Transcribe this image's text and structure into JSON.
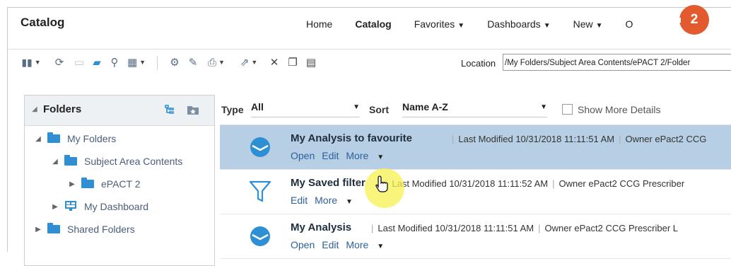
{
  "header": {
    "title": "Catalog",
    "nav": [
      {
        "label": "Home",
        "active": false,
        "dropdown": false
      },
      {
        "label": "Catalog",
        "active": true,
        "dropdown": false
      },
      {
        "label": "Favorites",
        "active": false,
        "dropdown": true
      },
      {
        "label": "Dashboards",
        "active": false,
        "dropdown": true
      },
      {
        "label": "New",
        "active": false,
        "dropdown": true
      },
      {
        "label": "O",
        "active": false,
        "dropdown": false
      }
    ],
    "step_badge": "2"
  },
  "toolbar": {
    "location_label": "Location",
    "location_value": "/My Folders/Subject Area Contents/ePACT 2/Folder"
  },
  "folders_panel": {
    "title": "Folders",
    "tree": [
      {
        "label": "My Folders",
        "icon": "folder-icon",
        "expanded": true
      },
      {
        "label": "Subject Area Contents",
        "icon": "folder-icon",
        "expanded": true
      },
      {
        "label": "ePACT 2",
        "icon": "folder-icon",
        "expanded": false
      },
      {
        "label": "My Dashboard",
        "icon": "dashboard-icon",
        "expanded": false
      },
      {
        "label": "Shared Folders",
        "icon": "folder-icon",
        "expanded": false
      }
    ]
  },
  "list": {
    "type_label": "Type",
    "type_value": "All",
    "sort_label": "Sort",
    "sort_value": "Name A-Z",
    "show_more_details": "Show More Details",
    "items": [
      {
        "name": "My Analysis to favourite",
        "meta": "Last Modified 10/31/2018 11:11:51 AM",
        "owner": "Owner ePact2 CCG",
        "actions": [
          "Open",
          "Edit",
          "More"
        ],
        "icon": "analysis-icon",
        "selected": true
      },
      {
        "name": "My Saved filter",
        "meta": "Last Modified 10/31/2018 11:11:52 AM",
        "owner": "Owner ePact2 CCG Prescriber",
        "actions": [
          "Edit",
          "More"
        ],
        "icon": "filter-icon",
        "selected": false
      },
      {
        "name": "My Analysis",
        "meta": "Last Modified 10/31/2018 11:11:51 AM",
        "owner": "Owner ePact2 CCG Prescriber L",
        "actions": [
          "Open",
          "Edit",
          "More"
        ],
        "icon": "analysis-icon",
        "selected": false
      }
    ]
  },
  "colors": {
    "selected_row": "#b7cfe4",
    "link": "#2e5f9a",
    "badge": "#e35a2e",
    "folder": "#2f8fd5"
  }
}
